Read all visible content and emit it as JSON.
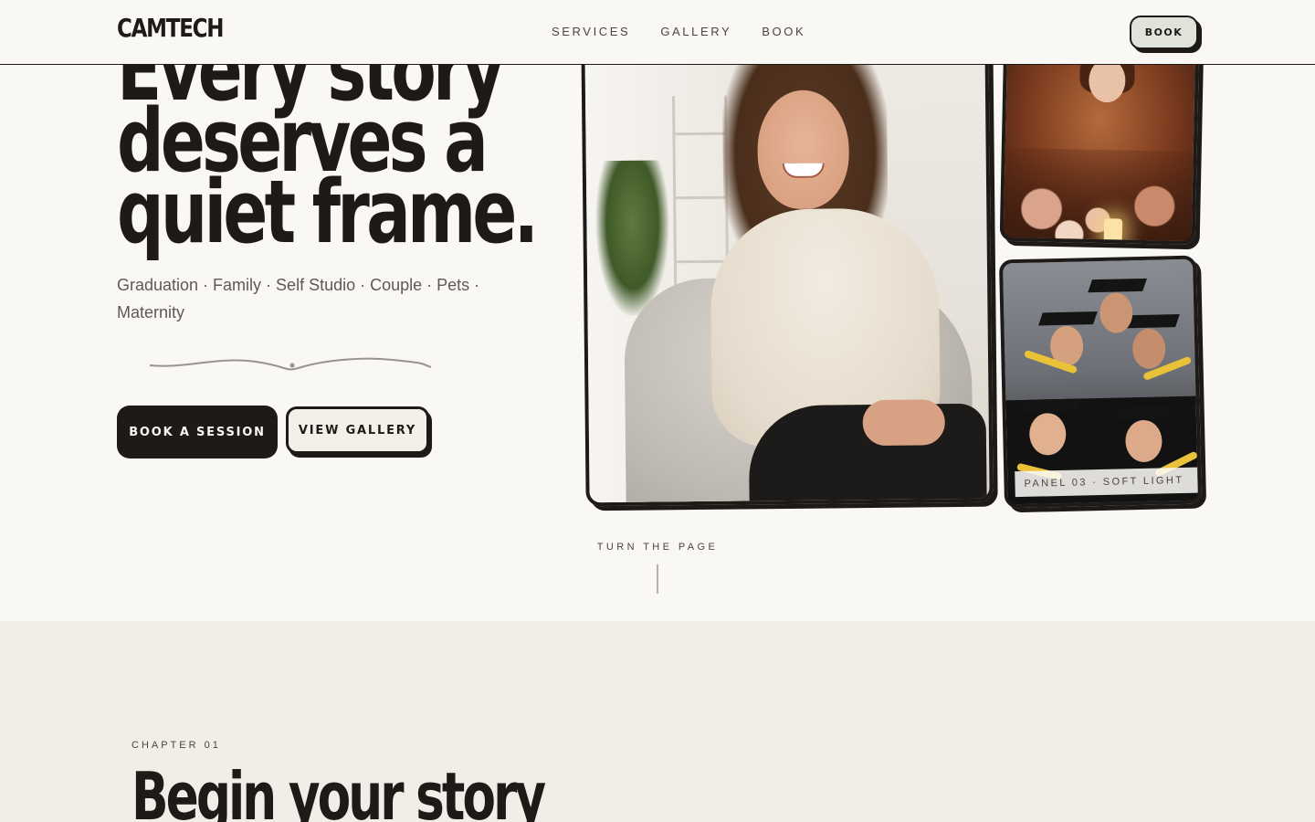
{
  "header": {
    "logo": "CAMTECH",
    "nav": [
      "SERVICES",
      "GALLERY",
      "BOOK"
    ],
    "book_button": "BOOK"
  },
  "hero": {
    "title_lines": [
      "Every story",
      "deserves a",
      "quiet frame."
    ],
    "subtitle": "Graduation · Family · Self Studio · Couple · Pets · Maternity",
    "primary_cta": "BOOK A SESSION",
    "secondary_cta": "VIEW GALLERY"
  },
  "panels": {
    "bottom_label": "PANEL 03 · SOFT LIGHT"
  },
  "turn_page": "TURN THE PAGE",
  "section2": {
    "eyebrow": "CHAPTER 01",
    "title": "Begin your story"
  },
  "colors": {
    "ink": "#1d1a18",
    "paper": "#faf8f4",
    "section_bg": "#f2ede6",
    "book_button_bg": "#dfe3da"
  }
}
